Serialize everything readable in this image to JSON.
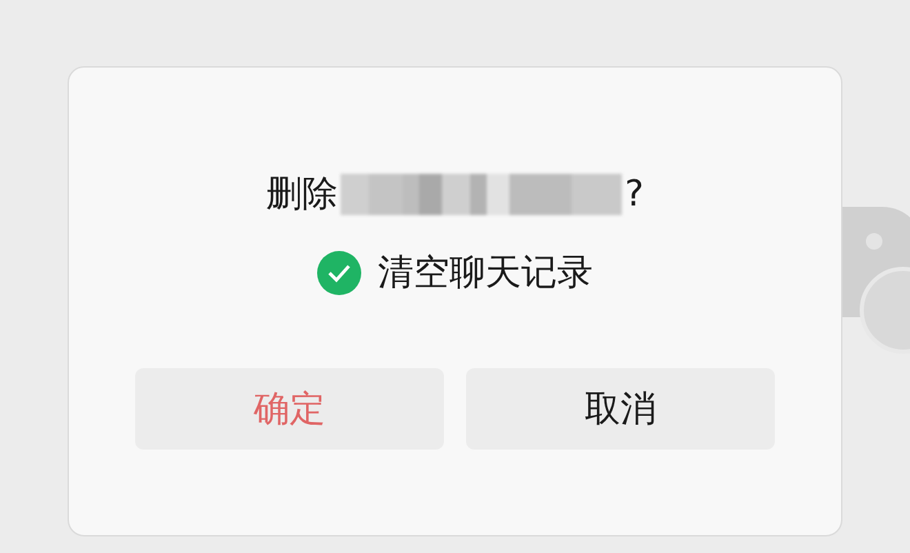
{
  "dialog": {
    "title_prefix": "删除",
    "title_suffix": "?",
    "title_redacted": true,
    "option": {
      "label": "清空聊天记录",
      "checked": true
    },
    "buttons": [
      {
        "label": "确定",
        "kind": "danger"
      },
      {
        "label": "取消",
        "kind": "normal"
      }
    ]
  }
}
